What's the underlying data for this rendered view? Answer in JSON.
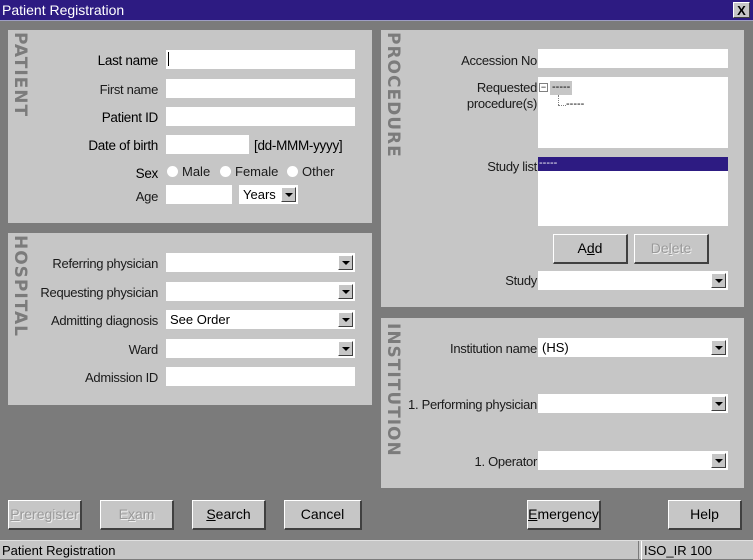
{
  "window": {
    "title": "Patient Registration",
    "close_label": "X"
  },
  "patient": {
    "section_label": "PATIENT",
    "last_name_label": "Last name",
    "last_name_value": "",
    "first_name_label": "First name",
    "first_name_value": "",
    "patient_id_label": "Patient ID",
    "patient_id_value": "",
    "dob_label": "Date of birth",
    "dob_value": "",
    "dob_format": "[dd-MMM-yyyy]",
    "sex_label": "Sex",
    "sex_options": [
      "Male",
      "Female",
      "Other"
    ],
    "age_label": "Age",
    "age_value": "",
    "age_unit": "Years"
  },
  "hospital": {
    "section_label": "HOSPITAL",
    "referring_physician_label": "Referring physician",
    "referring_physician_value": "",
    "requesting_physician_label": "Requesting physician",
    "requesting_physician_value": "",
    "admitting_diagnosis_label": "Admitting diagnosis",
    "admitting_diagnosis_value": "See Order",
    "ward_label": "Ward",
    "ward_value": "",
    "admission_id_label": "Admission ID",
    "admission_id_value": ""
  },
  "procedure": {
    "section_label": "PROCEDURE",
    "accession_label": "Accession No",
    "accession_value": "",
    "requested_label_line1": "Requested",
    "requested_label_line2": "procedure(s)",
    "tree_expander": "−",
    "tree_root": "-----",
    "tree_child": "-----",
    "study_list_label": "Study list",
    "study_list_items": [
      "-----"
    ],
    "add_label_pre": "A",
    "add_label_mnemonic": "d",
    "add_label_post": "d",
    "delete_label_pre": "De",
    "delete_label_mnemonic": "l",
    "delete_label_post": "ete",
    "study_label": "Study",
    "study_value": ""
  },
  "institution": {
    "section_label": "INSTITUTION",
    "institution_name_label": "Institution name",
    "institution_name_value": "(HS)",
    "performing_physician_label": "1. Performing physician",
    "performing_physician_value": "",
    "operator_label": "1. Operator",
    "operator_value": ""
  },
  "buttons": {
    "preregister_mnemonic": "P",
    "preregister_rest": "reregister",
    "exam_pre": "E",
    "exam_mnemonic": "x",
    "exam_post": "am",
    "search_mnemonic": "S",
    "search_rest": "earch",
    "cancel": "Cancel",
    "emergency_mnemonic": "E",
    "emergency_rest": "mergency",
    "help": "Help"
  },
  "statusbar": {
    "left": "Patient Registration",
    "right": "ISO_IR 100"
  }
}
